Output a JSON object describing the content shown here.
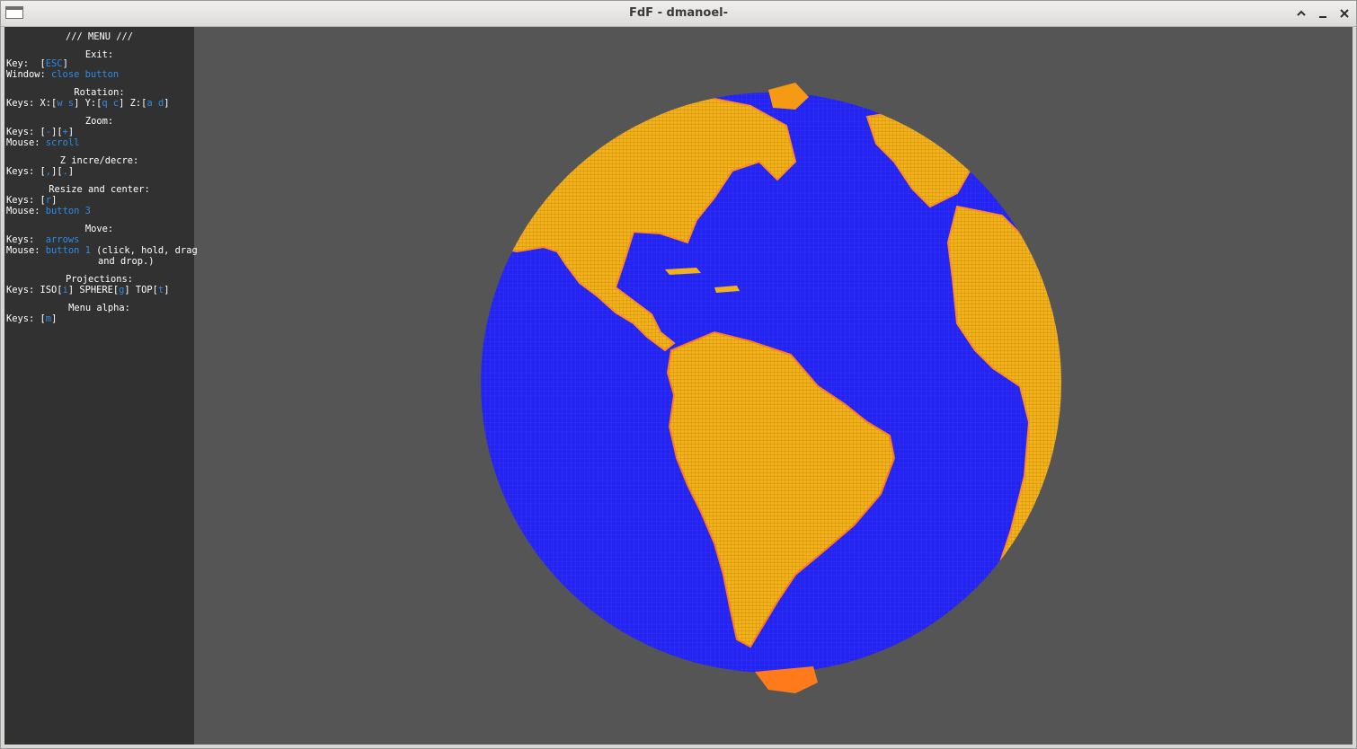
{
  "window": {
    "title": "FdF - dmanoel-"
  },
  "titlebar_icons": {
    "app": "window-icon",
    "maximize": "chevron-up-icon",
    "minimize": "minimize-icon",
    "close": "close-icon"
  },
  "menu": {
    "header": "/// MENU ///",
    "exit": {
      "title": "Exit:",
      "key_label": "Key:  [",
      "key_value": "ESC",
      "key_end": "]",
      "window_label": "Window: ",
      "window_value": "close button"
    },
    "rotation": {
      "title": "Rotation:",
      "prefix": "Keys: X:[",
      "x_keys": "w s",
      "y_prefix": "] Y:[",
      "y_keys": "q c",
      "z_prefix": "] Z:[",
      "z_keys": "a d",
      "end": "]"
    },
    "zoom": {
      "title": "Zoom:",
      "prefix": "Keys: [",
      "minus": "-",
      "mid": "][",
      "plus": "+",
      "end": "]",
      "mouse_label": "Mouse: ",
      "mouse_value": "scroll"
    },
    "z_incre": {
      "title": "Z incre/decre:",
      "prefix": "Keys: [",
      "k1": ",",
      "mid": "][",
      "k2": ".",
      "end": "]"
    },
    "resize": {
      "title": "Resize and center:",
      "prefix": "Keys: [",
      "key": "r",
      "end": "]",
      "mouse_label": "Mouse: ",
      "mouse_value": "button 3"
    },
    "move": {
      "title": "Move:",
      "keys_label": "Keys:  ",
      "keys_value": "arrows",
      "mouse_label": "Mouse: ",
      "mouse_value": "button 1",
      "mouse_rest": " (click, hold, drag",
      "line2": "and drop.)"
    },
    "projections": {
      "title": "Projections:",
      "p1": "Keys: ISO[",
      "iso": "i",
      "p2": "] SPHERE[",
      "sphere": "g",
      "p3": "] TOP[",
      "top": "t",
      "end": "]"
    },
    "alpha": {
      "title": "Menu alpha:",
      "prefix": "Keys: [",
      "key": "m",
      "end": "]"
    }
  },
  "colors": {
    "background": "#555555",
    "menu_bg": "#313131",
    "ocean": "#2424f0",
    "land": "#f2b21a",
    "land_high": "#ff7a1a",
    "key": "#2d8ce6"
  }
}
